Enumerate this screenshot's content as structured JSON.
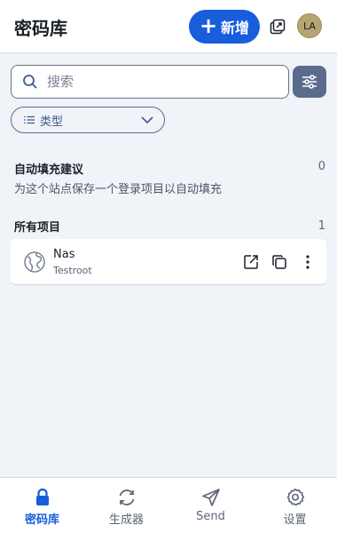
{
  "header": {
    "title": "密码库",
    "add_label": "新增",
    "avatar_initials": "LA"
  },
  "search": {
    "placeholder": "搜索",
    "value": ""
  },
  "filters": {
    "type_label": "类型"
  },
  "autofill": {
    "title": "自动填充建议",
    "count": "0",
    "hint": "为这个站点保存一个登录项目以自动填充"
  },
  "all_items": {
    "title": "所有项目",
    "count": "1",
    "items": [
      {
        "name": "Nas",
        "username": "Testroot"
      }
    ]
  },
  "nav": {
    "items": [
      {
        "label": "密码库",
        "icon": "lock-icon",
        "active": true
      },
      {
        "label": "生成器",
        "icon": "refresh-icon",
        "active": false
      },
      {
        "label": "Send",
        "icon": "send-icon",
        "active": false
      },
      {
        "label": "设置",
        "icon": "gear-icon",
        "active": false
      }
    ]
  },
  "colors": {
    "accent": "#175ddc",
    "background": "#f0f3f8",
    "filter_button": "#5b6b8c",
    "avatar": "#b8a472"
  }
}
